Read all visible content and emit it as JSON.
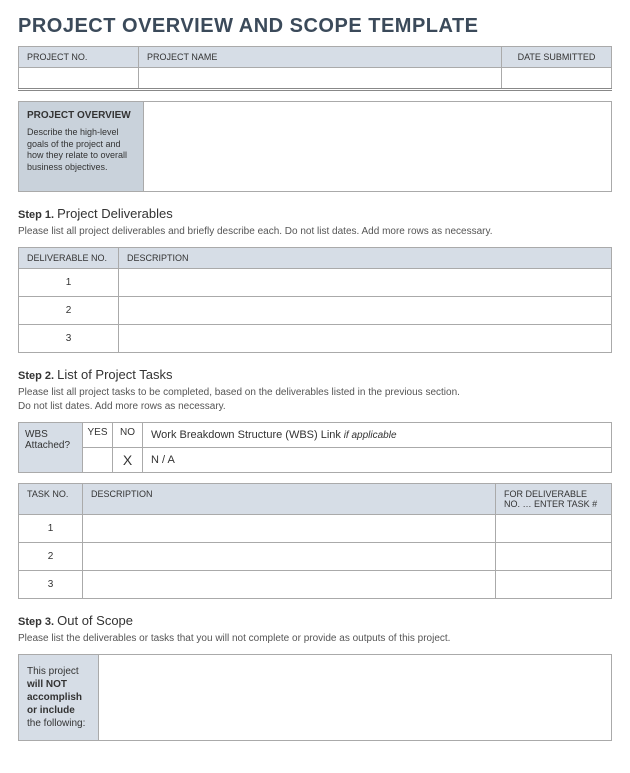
{
  "title": "PROJECT OVERVIEW AND SCOPE TEMPLATE",
  "header": {
    "project_no": "PROJECT NO.",
    "project_name": "PROJECT NAME",
    "date_submitted": "DATE SUBMITTED",
    "val_project_no": "",
    "val_project_name": "",
    "val_date_submitted": ""
  },
  "overview": {
    "label": "PROJECT OVERVIEW",
    "desc": "Describe the high-level goals of the project and how they relate to overall business objectives.",
    "value": ""
  },
  "step1": {
    "step": "Step 1.",
    "name": "Project Deliverables",
    "instr": "Please list all project deliverables and briefly describe each. Do not list dates. Add more rows as necessary.",
    "col_no": "DELIVERABLE NO.",
    "col_desc": "DESCRIPTION",
    "rows": [
      {
        "no": "1",
        "desc": ""
      },
      {
        "no": "2",
        "desc": ""
      },
      {
        "no": "3",
        "desc": ""
      }
    ]
  },
  "step2": {
    "step": "Step 2.",
    "name": "List of Project Tasks",
    "instr": "Please list all project tasks to be completed, based on the deliverables listed in the previous section.\nDo not list dates.  Add more rows as necessary.",
    "wbs": {
      "attached": "WBS Attached?",
      "yes": "YES",
      "no": "NO",
      "link_label": "Work Breakdown Structure (WBS) Link",
      "if_applic": " if applicable",
      "yes_val": "",
      "no_val": "X",
      "na": "N / A"
    },
    "col_task_no": "TASK NO.",
    "col_desc": "DESCRIPTION",
    "col_for": "FOR DELIVERABLE NO. … ENTER TASK #",
    "rows": [
      {
        "no": "1",
        "desc": "",
        "for": ""
      },
      {
        "no": "2",
        "desc": "",
        "for": ""
      },
      {
        "no": "3",
        "desc": "",
        "for": ""
      }
    ]
  },
  "step3": {
    "step": "Step 3.",
    "name": "Out of Scope",
    "instr": "Please list the deliverables or tasks that you will not complete or provide as outputs of this project.",
    "label_1": "This project",
    "label_2": "will NOT accomplish or include",
    "label_3": "the following:",
    "value": ""
  }
}
